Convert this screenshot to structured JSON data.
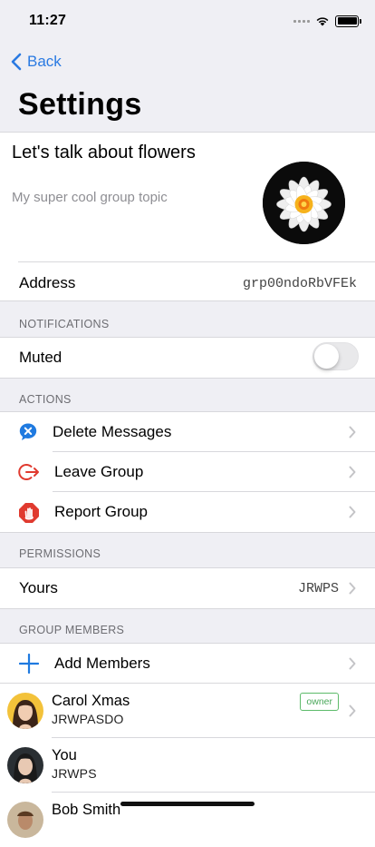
{
  "status": {
    "time": "11:27"
  },
  "nav": {
    "back_label": "Back",
    "title": "Settings"
  },
  "group": {
    "name": "Let's talk about flowers",
    "topic": "My super cool group topic",
    "address_label": "Address",
    "address_value": "grp00ndoRbVFEk"
  },
  "notifications": {
    "header": "NOTIFICATIONS",
    "muted_label": "Muted",
    "muted": false
  },
  "actions": {
    "header": "ACTIONS",
    "items": [
      {
        "label": "Delete Messages",
        "icon": "delete-messages-icon",
        "color": "#1f7ae0"
      },
      {
        "label": "Leave Group",
        "icon": "leave-group-icon",
        "color": "#e03a2f"
      },
      {
        "label": "Report Group",
        "icon": "report-group-icon",
        "color": "#e03a2f"
      }
    ]
  },
  "permissions": {
    "header": "PERMISSIONS",
    "yours_label": "Yours",
    "yours_value": "JRWPS"
  },
  "members": {
    "header": "GROUP MEMBERS",
    "add_label": "Add Members",
    "list": [
      {
        "name": "Carol Xmas",
        "id": "JRWPASDO",
        "badge": "owner"
      },
      {
        "name": "You",
        "id": "JRWPS",
        "badge": ""
      },
      {
        "name": "Bob Smith",
        "id": "",
        "badge": ""
      }
    ]
  },
  "colors": {
    "accent": "#2a7ae2",
    "danger": "#e03a2f",
    "badge": "#4aa85a"
  }
}
